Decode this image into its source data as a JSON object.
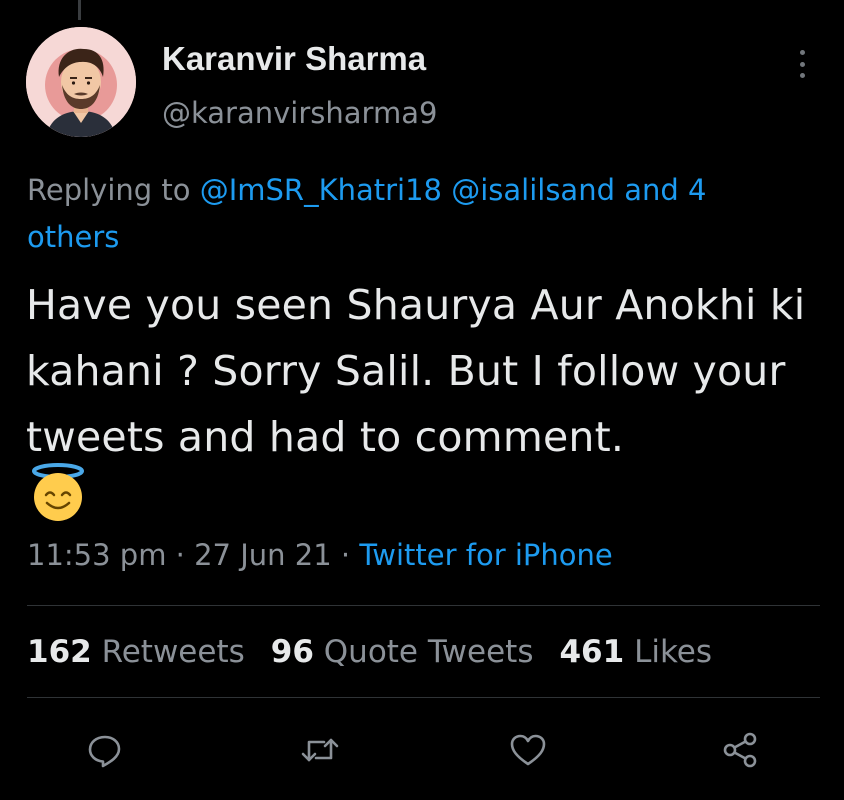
{
  "author": {
    "name": "Karanvir Sharma",
    "handle": "@karanvirsharma9"
  },
  "reply": {
    "prefix": "Replying to",
    "mentions": [
      "@ImSR_Khatri18",
      "@isalilsand"
    ],
    "tail": "and 4 others"
  },
  "tweet": {
    "text": "Have you seen Shaurya Aur Anokhi ki kahani ? Sorry Salil. But I follow your tweets and had to comment.",
    "emoji": "smiling-face-with-halo"
  },
  "meta": {
    "time": "11:53 pm",
    "date": "27 Jun 21",
    "source": "Twitter for iPhone"
  },
  "stats": {
    "retweets_count": "162",
    "retweets_label": "Retweets",
    "quotes_count": "96",
    "quotes_label": "Quote Tweets",
    "likes_count": "461",
    "likes_label": "Likes"
  },
  "actions": [
    "reply-icon",
    "retweet-icon",
    "like-icon",
    "share-icon"
  ],
  "colors": {
    "background": "#000000",
    "text": "#e7e9ea",
    "secondary": "#8b9198",
    "link": "#1d9bf0"
  }
}
